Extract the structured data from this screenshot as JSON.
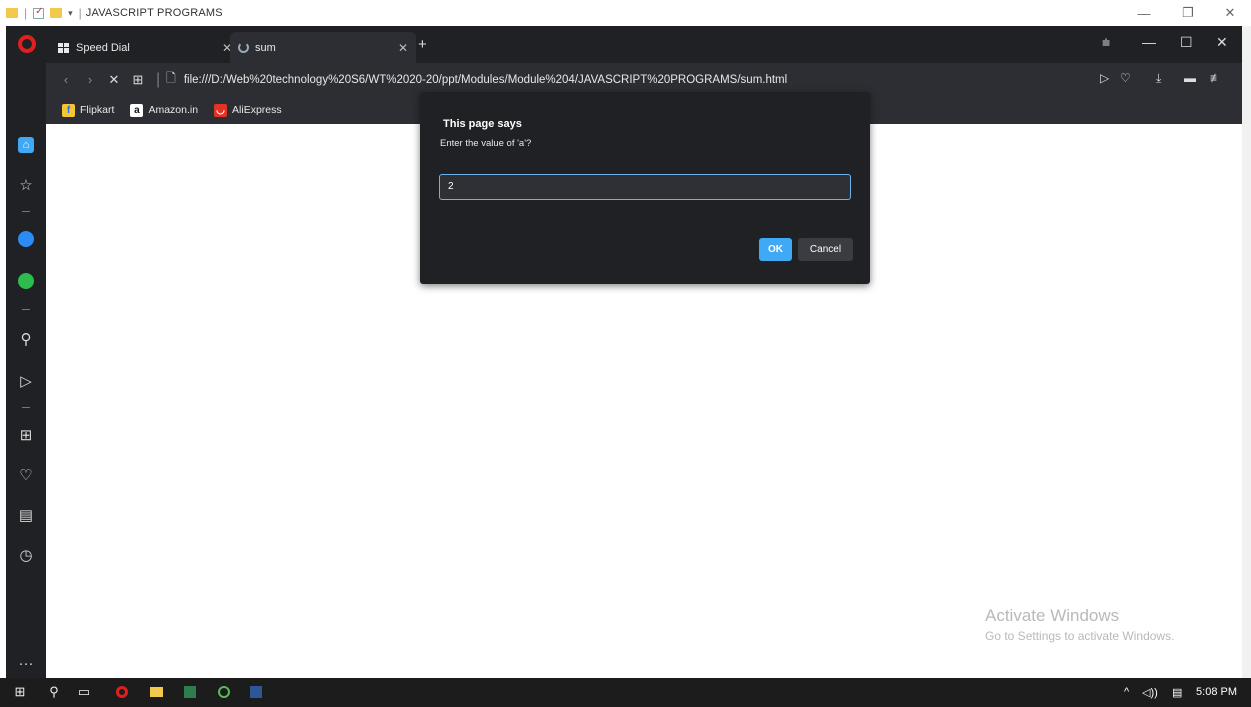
{
  "explorer": {
    "title": "JAVASCRIPT PROGRAMS",
    "minimize": "—",
    "restore": "❐",
    "close": "✕"
  },
  "tabs": [
    {
      "label": "Speed Dial",
      "close": "✕"
    },
    {
      "label": "sum",
      "close": "✕"
    }
  ],
  "new_tab": "+",
  "window_controls": {
    "menu": "⩧",
    "minimize": "—",
    "maximize": "☐",
    "close": "✕"
  },
  "address": {
    "back": "‹",
    "forward": "›",
    "stop": "✕",
    "tabs_icon": "⊞",
    "url": "file:///D:/Web%20technology%20S6/WT%2020-20/ppt/Modules/Module%204/JAVASCRIPT%20PROGRAMS/sum.html"
  },
  "bookmarks": [
    {
      "label": "Flipkart",
      "icon_color": "#f7c531",
      "icon_char": "f"
    },
    {
      "label": "Amazon.in",
      "icon_color": "#ffffff",
      "icon_char": "a"
    },
    {
      "label": "AliExpress",
      "icon_color": "#e43225",
      "icon_char": "◡"
    }
  ],
  "dialog": {
    "title": "This page says",
    "message": "Enter the value of 'a'?",
    "input_value": "2",
    "ok_label": "OK",
    "cancel_label": "Cancel"
  },
  "watermark": {
    "title": "Activate Windows",
    "subtitle": "Go to Settings to activate Windows."
  },
  "sidebar": {
    "more": "···"
  },
  "taskbar": {
    "time": "5:08 PM"
  },
  "colors": {
    "chrome_dark": "#202124",
    "accent_blue": "#3fa9f5",
    "opera_red": "#e0201f"
  }
}
